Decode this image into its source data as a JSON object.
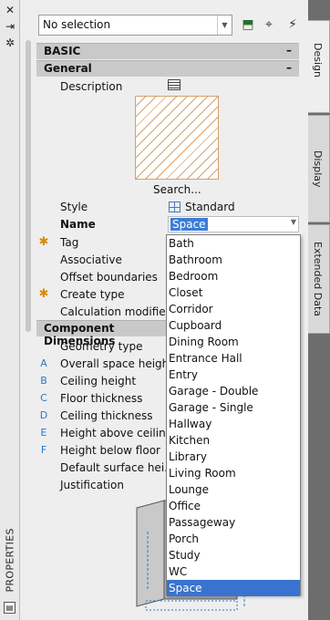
{
  "palette": {
    "title": "PROPERTIES"
  },
  "left_icons": [
    "close-icon",
    "pin-icon",
    "settings-icon"
  ],
  "toolbar": {
    "selection_value": "No selection",
    "buttons": [
      "add-object-icon",
      "select-objects-icon",
      "quick-select-icon"
    ]
  },
  "sections": {
    "basic": {
      "label": "BASIC",
      "toggle": "–"
    },
    "general": {
      "label": "General",
      "toggle": "–"
    },
    "component": {
      "label": "Component Dimensions"
    }
  },
  "general_rows": {
    "description": "Description",
    "search_link": "Search...",
    "style_label": "Style",
    "style_value": "Standard",
    "name_label": "Name",
    "name_value": "Space",
    "tag": "Tag",
    "associative": "Associative",
    "offset_boundaries": "Offset boundaries",
    "create_type": "Create type",
    "calculation": "Calculation modifie..."
  },
  "component_rows": [
    {
      "mark": "",
      "label": "Geometry type"
    },
    {
      "mark": "A",
      "label": "Overall space height"
    },
    {
      "mark": "B",
      "label": "Ceiling height"
    },
    {
      "mark": "C",
      "label": "Floor thickness"
    },
    {
      "mark": "D",
      "label": "Ceiling thickness"
    },
    {
      "mark": "E",
      "label": "Height above ceiling"
    },
    {
      "mark": "F",
      "label": "Height below floor"
    },
    {
      "mark": "",
      "label": "Default surface hei..."
    },
    {
      "mark": "",
      "label": "Justification"
    }
  ],
  "dropdown": {
    "items": [
      "Bath",
      "Bathroom",
      "Bedroom",
      "Closet",
      "Corridor",
      "Cupboard",
      "Dining Room",
      "Entrance Hall",
      "Entry",
      "Garage - Double",
      "Garage - Single",
      "Hallway",
      "Kitchen",
      "Library",
      "Living Room",
      "Lounge",
      "Office",
      "Passageway",
      "Porch",
      "Study",
      "WC",
      "Space"
    ],
    "selected": "Space"
  },
  "tabs": {
    "design": "Design",
    "display": "Display",
    "extended": "Extended Data"
  },
  "colors": {
    "accent": "#3a73cf",
    "hatch": "#d3a16b",
    "star": "#d98a00",
    "letter": "#2a78c8"
  }
}
